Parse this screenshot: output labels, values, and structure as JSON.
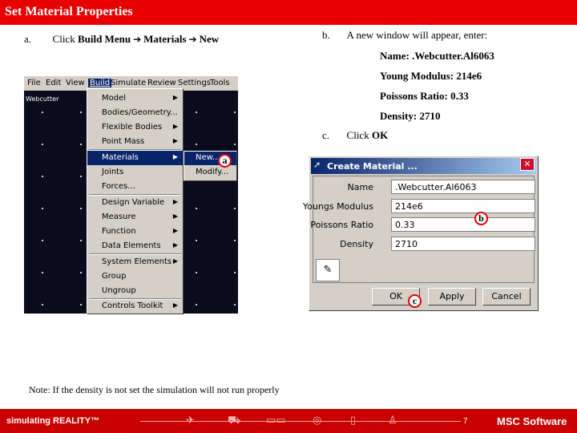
{
  "slide": {
    "title": "Set Material Properties",
    "note": "Note: If the density is not set the simulation will not run properly"
  },
  "steps": {
    "a_marker": "a.",
    "a_prefix": "Click ",
    "a_path": [
      "Build Menu",
      "Materials",
      "New"
    ],
    "b_marker": "b.",
    "b_text": "A new window will appear, enter:",
    "b_entries": [
      "Name: .Webcutter.Al6063",
      "Young Modulus: 214e6",
      "Poissons Ratio: 0.33",
      "Density: 2710"
    ],
    "c_marker": "c.",
    "c_prefix": "Click ",
    "c_action": "OK"
  },
  "adams": {
    "menubar": [
      "File",
      "Edit",
      "View",
      "Build",
      "Simulate",
      "Review",
      "Settings",
      "Tools"
    ],
    "tree_label": "Webcutter",
    "build_menu": [
      {
        "label": "Model",
        "arrow": true
      },
      {
        "label": "Bodies/Geometry...",
        "arrow": false
      },
      {
        "label": "Flexible Bodies",
        "arrow": true
      },
      {
        "label": "Point Mass",
        "arrow": true
      },
      {
        "label": "Materials",
        "arrow": true
      },
      {
        "label": "Joints",
        "arrow": false
      },
      {
        "label": "Forces...",
        "arrow": false
      },
      {
        "label": "Design Variable",
        "arrow": true
      },
      {
        "label": "Measure",
        "arrow": true
      },
      {
        "label": "Function",
        "arrow": true
      },
      {
        "label": "Data Elements",
        "arrow": true
      },
      {
        "label": "System Elements",
        "arrow": true
      },
      {
        "label": "Group",
        "arrow": false
      },
      {
        "label": "Ungroup",
        "arrow": false
      },
      {
        "label": "Controls Toolkit",
        "arrow": true
      }
    ],
    "materials_submenu": [
      "New...",
      "Modify..."
    ]
  },
  "callouts": [
    "a",
    "b",
    "c"
  ],
  "dialog": {
    "title": "Create Material ...",
    "fields": [
      {
        "label": "Name",
        "value": ".Webcutter.Al6063"
      },
      {
        "label": "Youngs Modulus",
        "value": "214e6"
      },
      {
        "label": "Poissons Ratio",
        "value": "0.33"
      },
      {
        "label": "Density",
        "value": "2710"
      }
    ],
    "buttons": {
      "ok": "OK",
      "apply": "Apply",
      "cancel": "Cancel"
    }
  },
  "footer": {
    "brand": "simulating REALITY™",
    "page": "7",
    "logo": "MSC Software"
  },
  "colors": {
    "accent": "#e60000",
    "footer": "#c80000",
    "highlight": "#0a246a"
  }
}
